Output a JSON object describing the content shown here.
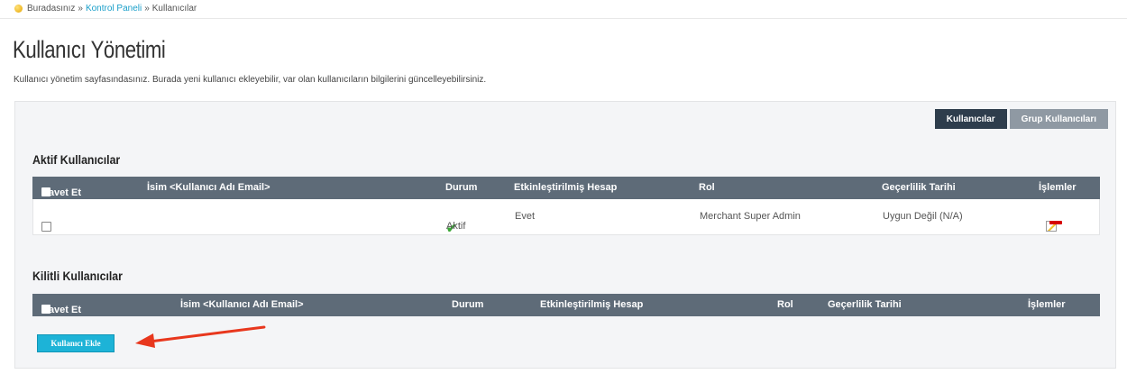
{
  "breadcrumb": {
    "here": "Buradasınız",
    "sep1": "»",
    "link": "Kontrol Paneli",
    "sep2": "»",
    "current": "Kullanıcılar"
  },
  "page": {
    "title": "Kullanıcı Yönetimi",
    "description": "Kullanıcı yönetim sayfasındasınız. Burada yeni kullanıcı ekleyebilir, var olan kullanıcıların bilgilerini güncelleyebilirsiniz."
  },
  "tabs": [
    {
      "label": "Kullanıcılar",
      "active": true
    },
    {
      "label": "Grup Kullanıcıları",
      "active": false
    }
  ],
  "active_users": {
    "title": "Aktif Kullanıcılar",
    "headers": [
      "Davet Et",
      "İsim <Kullanıcı Adı Email>",
      "Durum",
      "Etkinleştirilmiş Hesap",
      "Rol",
      "Geçerlilik Tarihi",
      "İşlemler"
    ],
    "rows": [
      {
        "name": "",
        "status": "Aktif",
        "enabled": "Evet",
        "role": "Merchant Super Admin",
        "validity": "Uygun Değil (N/A)"
      }
    ]
  },
  "locked_users": {
    "title": "Kilitli Kullanıcılar",
    "headers": [
      "Davet Et",
      "İsim <Kullanıcı Adı Email>",
      "Durum",
      "Etkinleştirilmiş Hesap",
      "Rol",
      "Geçerlilik Tarihi",
      "İşlemler"
    ]
  },
  "add_button": "Kullanıcı Ekle",
  "colors": {
    "header_bg": "#5e6b78",
    "active_tab": "#2e3d4c",
    "inactive_tab": "#8f99a3",
    "add_button": "#1db3d7",
    "arrow": "#e8371d",
    "status_ok": "#3aa635",
    "delete": "#d60000"
  }
}
